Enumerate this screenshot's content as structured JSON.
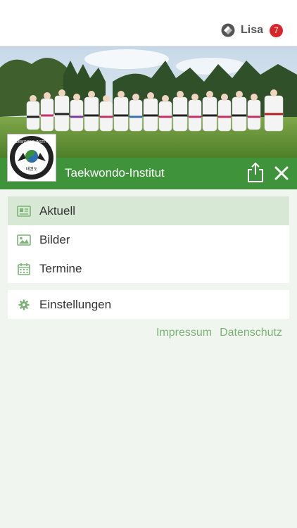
{
  "header": {
    "user_name": "Lisa",
    "notification_count": "7",
    "user_logo_icon": "app-logo-icon"
  },
  "club": {
    "name": "Taekwondo-Institut",
    "logo_text": "TAEKWONDO-INSTITUT",
    "logo_korean": "태권도"
  },
  "menu": {
    "items": [
      {
        "label": "Aktuell",
        "icon": "newspaper-icon",
        "active": true
      },
      {
        "label": "Bilder",
        "icon": "image-icon",
        "active": false
      },
      {
        "label": "Termine",
        "icon": "calendar-icon",
        "active": false
      }
    ],
    "settings": {
      "label": "Einstellungen",
      "icon": "gear-icon"
    }
  },
  "footer": {
    "impressum": "Impressum",
    "datenschutz": "Datenschutz"
  },
  "colors": {
    "accent": "#3f943b",
    "active_row": "#d7e9d4",
    "link": "#7bb377",
    "badge": "#d9252a",
    "background": "#f0f6ef"
  }
}
